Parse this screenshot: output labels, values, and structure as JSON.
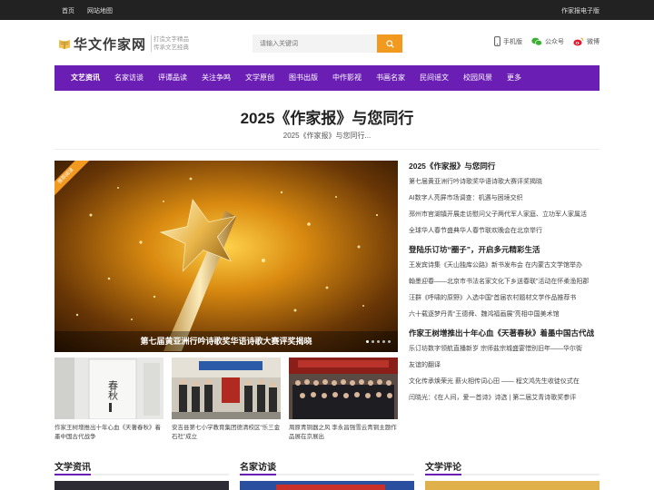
{
  "topbar": {
    "home": "首页",
    "sitemap": "网站地图",
    "epaper": "作家报电子版"
  },
  "header": {
    "logo_text": "华文作家网",
    "slogan_line1": "打造文字精品",
    "slogan_line2": "传承文艺经典",
    "search_placeholder": "请输入关键词",
    "links": {
      "mobile": "手机版",
      "wechat": "公众号",
      "weibo": "微博"
    }
  },
  "nav": {
    "items": [
      "文艺资讯",
      "名家访谈",
      "评谭品读",
      "关注争鸣",
      "文学原创",
      "图书出版",
      "中作影视",
      "书画名家",
      "民间谣文",
      "校园风景",
      "更多"
    ]
  },
  "headline": {
    "title": "2025《作家报》与您同行",
    "subtitle": "2025《作家报》与您同行..."
  },
  "slider": {
    "ribbon": "推荐阅读",
    "caption": "第七届黄亚洲行吟诗歌奖华语诗歌大赛评奖揭晓"
  },
  "news": [
    {
      "title": "2025《作家报》与您同行",
      "items": [
        "第七届黄亚洲行吟诗歌奖华语诗歌大赛评奖揭晓",
        "AI数字人亮屏市场调查：机遇与困境交织",
        "邳州市官湖镇开展走访慰问父子两代军人家庭、立功军人家属活",
        "全球华人春节盛典华人春节联欢晚会在北京举行"
      ]
    },
    {
      "title": "登陆乐订坊“圈子”，开启多元精彩生活",
      "items": [
        "王发宾诗集《天山独库公路》新书发布会 在内蒙古文学馆举办",
        "翰墨迎春——北京市书法名家文化下乡送春联”活动在怀柔渔阳郡",
        "汪群《呼啸的原野》入选中国“首届农村题材文学作品推荐书",
        "六十载逐梦丹青“王德舜、魏鸿福画展”亮相中国美术馆"
      ]
    },
    {
      "title": "作家王树增推出十年心血《天著春秋》着墨中国古代战",
      "items": [
        "乐订坊数字领航直播新岁 宗师盐宗城盛宴惜别旧年——华尔街",
        "友谊的翻译",
        "文化传承焕荣光 薪火相传词心田 —— 程文鸿先生收徒仪式在",
        "闫晓光：《在人间，爱一首诗》诗选 | 第二届艾青诗歌奖参评"
      ]
    }
  ],
  "thumbs": [
    {
      "caption": "作家王树增推出十年心血《天著春秋》着墨中国古代战争"
    },
    {
      "caption": "安吉县第七小学教育集团德清校区“乐三金石社”成立"
    },
    {
      "caption": "周原青铜器之风 李永昌强雪云青铜主题作品展在京展出"
    }
  ],
  "thumb_book_text": "春秋",
  "sections": [
    {
      "title": "文学资讯"
    },
    {
      "title": "名家访谈"
    },
    {
      "title": "文学评论"
    }
  ],
  "colors": {
    "nav_bg": "#6a1eb4",
    "accent_orange": "#f29a1f",
    "topbar_bg": "#222222"
  }
}
